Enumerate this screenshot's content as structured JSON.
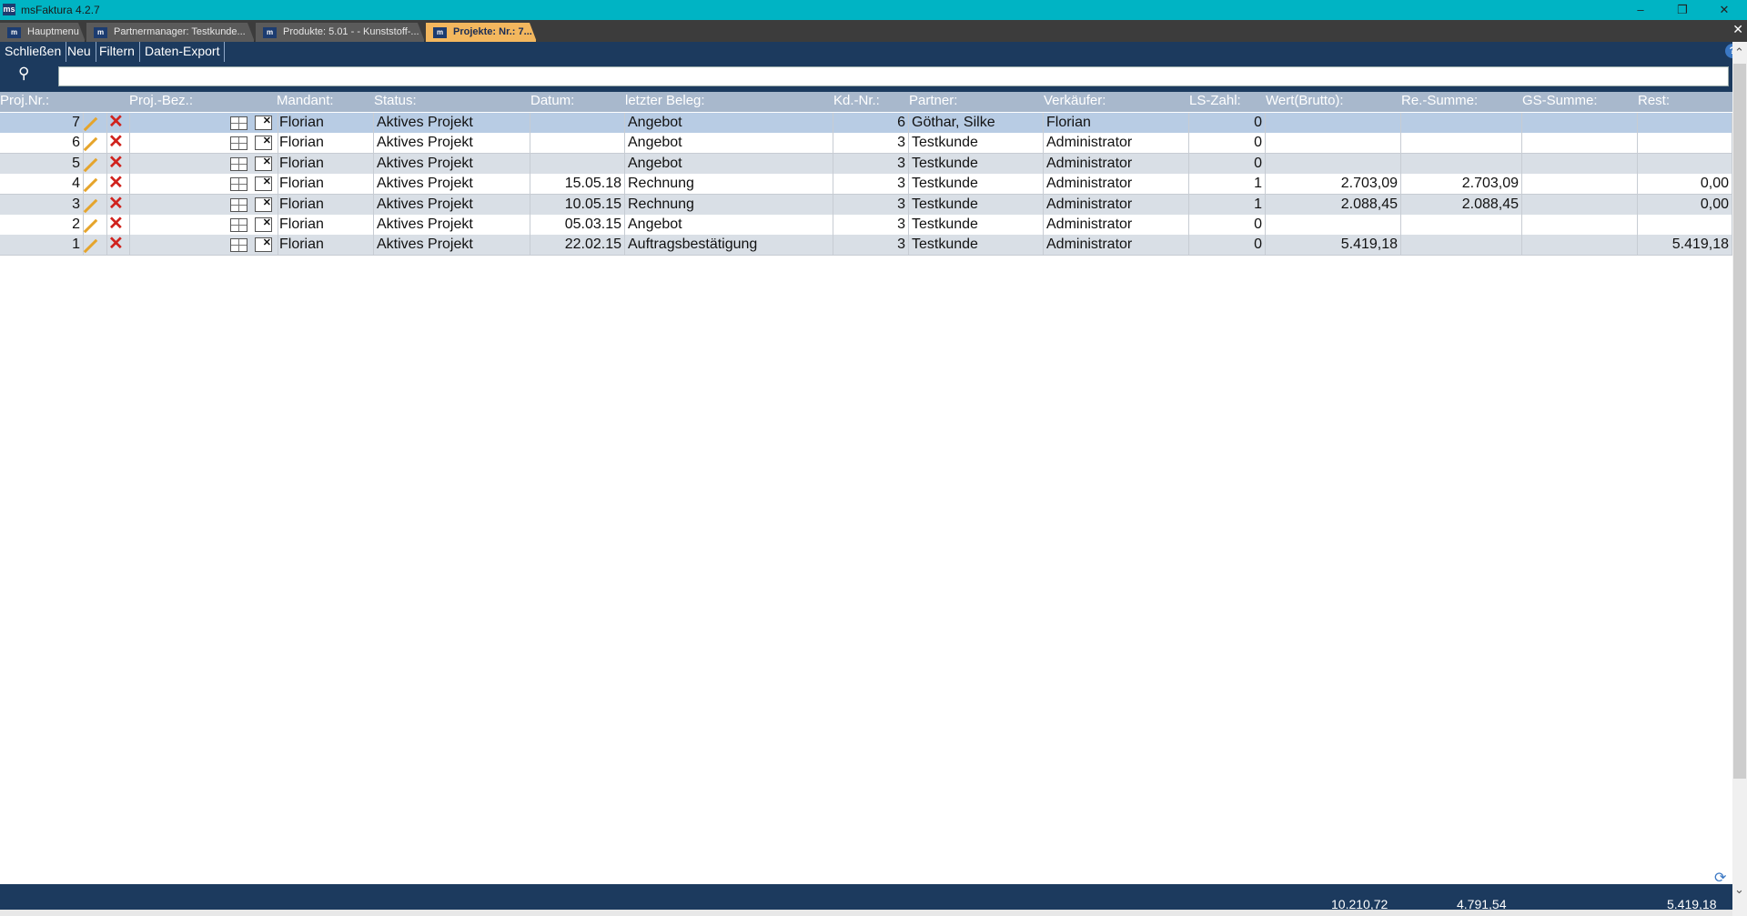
{
  "window": {
    "title": "msFaktura 4.2.7",
    "app_icon": "msfaktura-icon"
  },
  "tabs": [
    {
      "label": "Hauptmenu"
    },
    {
      "label": "Partnermanager: Testkunde..."
    },
    {
      "label": "Produkte: 5.01 - - Kunststoff-..."
    },
    {
      "label": "Projekte: Nr.: 7..."
    }
  ],
  "toolbar": {
    "close": "Schließen",
    "new": "Neu",
    "filter": "Filtern",
    "export": "Daten-Export",
    "help": "?"
  },
  "search": {
    "value": "",
    "placeholder": ""
  },
  "columns": {
    "proj_nr": "Proj.Nr.:",
    "proj_bez": "Proj.-Bez.:",
    "mandant": "Mandant:",
    "status": "Status:",
    "datum": "Datum:",
    "beleg": "letzter Beleg:",
    "kdnr": "Kd.-Nr.:",
    "partner": "Partner:",
    "verkaeufer": "Verkäufer:",
    "ls": "LS-Zahl:",
    "wert": "Wert(Brutto):",
    "re": "Re.-Summe:",
    "gs": "GS-Summe:",
    "rest": "Rest:"
  },
  "rows": [
    {
      "nr": "7",
      "bez": "",
      "mandant": "Florian",
      "status": "Aktives Projekt",
      "datum": "",
      "beleg": "Angebot",
      "kdnr": "6",
      "partner": "Göthar, Silke",
      "verkaeufer": "Florian",
      "ls": "0",
      "wert": "",
      "re": "",
      "gs": "",
      "rest": ""
    },
    {
      "nr": "6",
      "bez": "",
      "mandant": "Florian",
      "status": "Aktives Projekt",
      "datum": "",
      "beleg": "Angebot",
      "kdnr": "3",
      "partner": "Testkunde",
      "verkaeufer": "Administrator",
      "ls": "0",
      "wert": "",
      "re": "",
      "gs": "",
      "rest": ""
    },
    {
      "nr": "5",
      "bez": "",
      "mandant": "Florian",
      "status": "Aktives Projekt",
      "datum": "",
      "beleg": "Angebot",
      "kdnr": "3",
      "partner": "Testkunde",
      "verkaeufer": "Administrator",
      "ls": "0",
      "wert": "",
      "re": "",
      "gs": "",
      "rest": ""
    },
    {
      "nr": "4",
      "bez": "",
      "mandant": "Florian",
      "status": "Aktives Projekt",
      "datum": "15.05.18",
      "beleg": "Rechnung",
      "kdnr": "3",
      "partner": "Testkunde",
      "verkaeufer": "Administrator",
      "ls": "1",
      "wert": "2.703,09",
      "re": "2.703,09",
      "gs": "",
      "rest": "0,00"
    },
    {
      "nr": "3",
      "bez": "",
      "mandant": "Florian",
      "status": "Aktives Projekt",
      "datum": "10.05.15",
      "beleg": "Rechnung",
      "kdnr": "3",
      "partner": "Testkunde",
      "verkaeufer": "Administrator",
      "ls": "1",
      "wert": "2.088,45",
      "re": "2.088,45",
      "gs": "",
      "rest": "0,00"
    },
    {
      "nr": "2",
      "bez": "",
      "mandant": "Florian",
      "status": "Aktives Projekt",
      "datum": "05.03.15",
      "beleg": "Angebot",
      "kdnr": "3",
      "partner": "Testkunde",
      "verkaeufer": "Administrator",
      "ls": "0",
      "wert": "",
      "re": "",
      "gs": "",
      "rest": ""
    },
    {
      "nr": "1",
      "bez": "",
      "mandant": "Florian",
      "status": "Aktives Projekt",
      "datum": "22.02.15",
      "beleg": "Auftragsbestätigung",
      "kdnr": "3",
      "partner": "Testkunde",
      "verkaeufer": "Administrator",
      "ls": "0",
      "wert": "5.419,18",
      "re": "",
      "gs": "",
      "rest": "5.419,18"
    }
  ],
  "totals": {
    "wert": "10.210,72",
    "re": "4.791,54",
    "rest": "5.419,18"
  },
  "colors": {
    "titlebar": "#00b4c4",
    "toolbar": "#1c3a5e",
    "header": "#a8b8cc",
    "selected_row": "#b8cce4",
    "active_tab": "#f3b75e"
  }
}
